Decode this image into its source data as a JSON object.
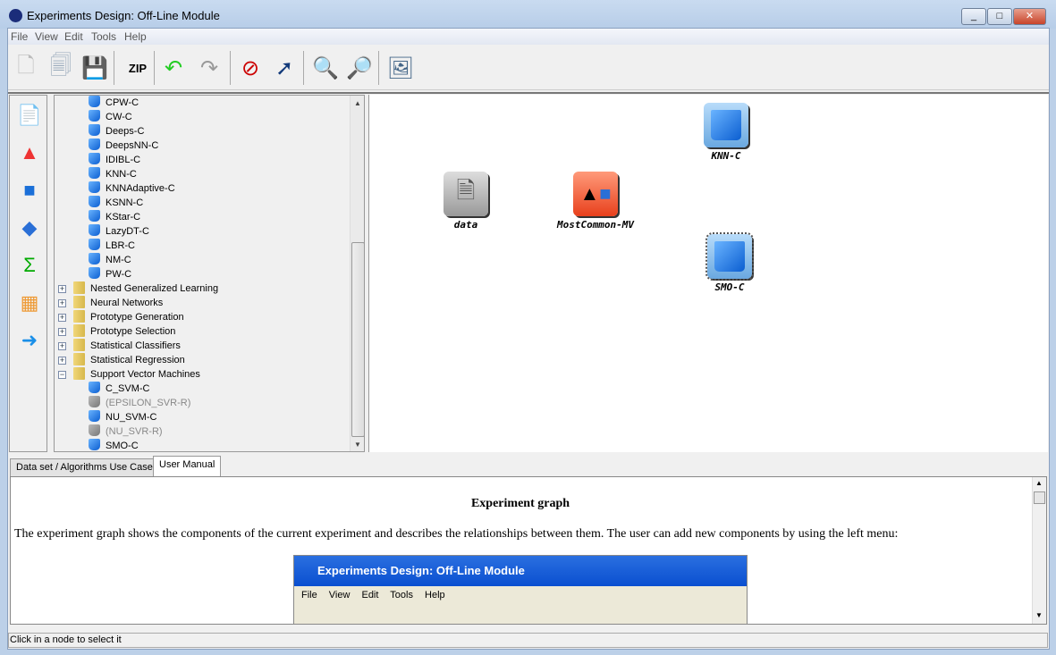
{
  "window": {
    "title": "Experiments Design: Off-Line Module",
    "controls": [
      "_",
      "□",
      "✕"
    ]
  },
  "menu": [
    "File",
    "View",
    "Edit",
    "Tools",
    "Help"
  ],
  "toolbar": [
    {
      "name": "new-icon",
      "glyph": "🗋"
    },
    {
      "name": "open-icon",
      "glyph": "🗐"
    },
    {
      "name": "save-icon",
      "glyph": "💾"
    },
    {
      "name": "zip-icon",
      "glyph": "ZIP"
    },
    {
      "name": "undo-icon",
      "glyph": "↶"
    },
    {
      "name": "redo-icon",
      "glyph": "↷"
    },
    {
      "name": "stop-icon",
      "glyph": "⊘"
    },
    {
      "name": "pointer-icon",
      "glyph": "➚"
    },
    {
      "name": "help-search-icon",
      "glyph": "🔍"
    },
    {
      "name": "inspect-icon",
      "glyph": "🔎"
    },
    {
      "name": "image-icon",
      "glyph": "🖼"
    }
  ],
  "strip": [
    {
      "name": "dataset-icon",
      "glyph": "📄"
    },
    {
      "name": "preprocess-icon",
      "glyph": "▲"
    },
    {
      "name": "method-icon",
      "glyph": "■"
    },
    {
      "name": "postprocess-icon",
      "glyph": "◆"
    },
    {
      "name": "statistics-icon",
      "glyph": "Σ"
    },
    {
      "name": "visualize-icon",
      "glyph": "▦"
    },
    {
      "name": "connect-arrow-icon",
      "glyph": "➜"
    }
  ],
  "tree": [
    {
      "label": "CPW-C",
      "type": "leaf"
    },
    {
      "label": "CW-C",
      "type": "leaf"
    },
    {
      "label": "Deeps-C",
      "type": "leaf"
    },
    {
      "label": "DeepsNN-C",
      "type": "leaf"
    },
    {
      "label": "IDIBL-C",
      "type": "leaf"
    },
    {
      "label": "KNN-C",
      "type": "leaf"
    },
    {
      "label": "KNNAdaptive-C",
      "type": "leaf"
    },
    {
      "label": "KSNN-C",
      "type": "leaf"
    },
    {
      "label": "KStar-C",
      "type": "leaf"
    },
    {
      "label": "LazyDT-C",
      "type": "leaf"
    },
    {
      "label": "LBR-C",
      "type": "leaf"
    },
    {
      "label": "NM-C",
      "type": "leaf"
    },
    {
      "label": "PW-C",
      "type": "leaf"
    },
    {
      "label": "Nested Generalized Learning",
      "type": "folder"
    },
    {
      "label": "Neural Networks",
      "type": "folder"
    },
    {
      "label": "Prototype Generation",
      "type": "folder"
    },
    {
      "label": "Prototype Selection",
      "type": "folder"
    },
    {
      "label": "Statistical Classifiers",
      "type": "folder"
    },
    {
      "label": "Statistical Regression",
      "type": "folder"
    },
    {
      "label": "Support Vector Machines",
      "type": "open"
    },
    {
      "label": "C_SVM-C",
      "type": "leaf"
    },
    {
      "label": "(EPSILON_SVR-R)",
      "type": "disabled"
    },
    {
      "label": "NU_SVM-C",
      "type": "leaf"
    },
    {
      "label": "(NU_SVR-R)",
      "type": "disabled"
    },
    {
      "label": "SMO-C",
      "type": "leaf"
    }
  ],
  "graph": {
    "nodes": [
      {
        "label": "data"
      },
      {
        "label": "MostCommon-MV"
      },
      {
        "label": "KNN-C"
      },
      {
        "label": "SMO-C"
      }
    ]
  },
  "tabs": [
    "Data set / Algorithms Use Case",
    "User Manual"
  ],
  "manual": {
    "heading": "Experiment graph",
    "paragraph": "The experiment graph shows the components of the current experiment and describes the relationships between them. The user can add new components by using the left menu:",
    "shot_title": "Experiments Design: Off-Line Module",
    "shot_menu": "File View Edit Tools Help"
  },
  "status": "Click in a node to select it"
}
